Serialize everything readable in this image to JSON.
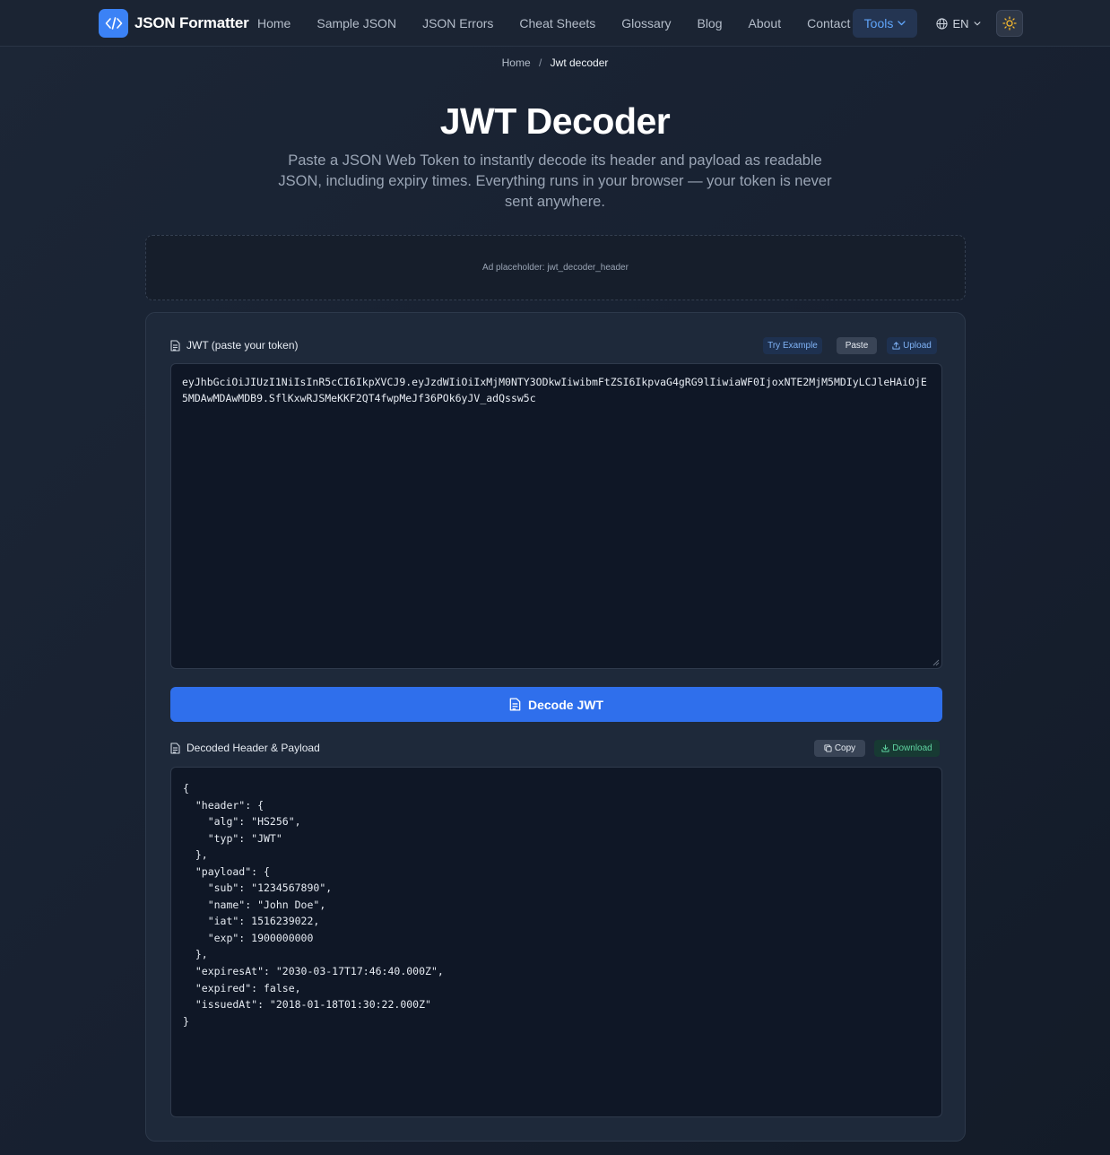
{
  "nav": {
    "brand": "JSON Formatter",
    "links": [
      "Home",
      "Sample JSON",
      "JSON Errors",
      "Cheat Sheets",
      "Glossary",
      "Blog",
      "About",
      "Contact"
    ],
    "tools_label": "Tools",
    "lang_label": "EN"
  },
  "breadcrumb": {
    "home": "Home",
    "separator": "/",
    "current": "Jwt decoder"
  },
  "hero": {
    "title": "JWT Decoder",
    "subtitle": "Paste a JSON Web Token to instantly decode its header and payload as readable JSON, including expiry times. Everything runs in your browser — your token is never sent anywhere."
  },
  "ad": {
    "text": "Ad placeholder: jwt_decoder_header"
  },
  "input_section": {
    "label": "JWT (paste your token)",
    "try_example": "Try Example",
    "paste": "Paste",
    "upload": "Upload",
    "token": "eyJhbGciOiJIUzI1NiIsInR5cCI6IkpXVCJ9.eyJzdWIiOiIxMjM0NTY3ODkwIiwibmFtZSI6IkpvaG4gRG9lIiwiaWF0IjoxNTE2MjM5MDIyLCJleHAiOjE5MDAwMDAwMDB9.SflKxwRJSMeKKF2QT4fwpMeJf36POk6yJV_adQssw5c"
  },
  "decode_button": "Decode JWT",
  "output_section": {
    "label": "Decoded Header & Payload",
    "copy": "Copy",
    "download": "Download",
    "content": "{\n  \"header\": {\n    \"alg\": \"HS256\",\n    \"typ\": \"JWT\"\n  },\n  \"payload\": {\n    \"sub\": \"1234567890\",\n    \"name\": \"John Doe\",\n    \"iat\": 1516239022,\n    \"exp\": 1900000000\n  },\n  \"expiresAt\": \"2030-03-17T17:46:40.000Z\",\n  \"expired\": false,\n  \"issuedAt\": \"2018-01-18T01:30:22.000Z\"\n}"
  },
  "colors": {
    "background": "#182130",
    "accent": "#3b82f6",
    "primary_button": "#2f6fec",
    "download_green": "#5fd3a1"
  },
  "icons": {
    "brand": "code-brackets-icon",
    "tools_chevron": "chevron-down-icon",
    "language": "globe-icon",
    "theme": "sun-icon",
    "section": "document-icon",
    "upload": "upload-icon",
    "copy": "copy-icon",
    "download": "download-icon"
  }
}
